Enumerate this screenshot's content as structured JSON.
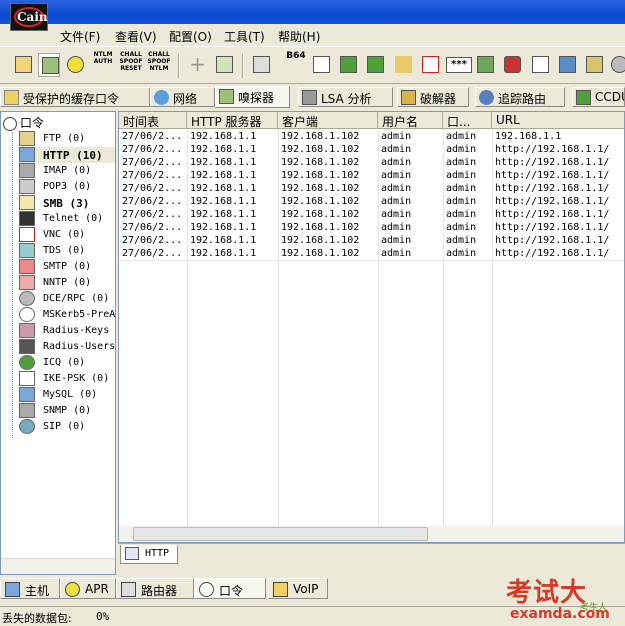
{
  "app": {
    "logo_text": "Cain"
  },
  "menu": [
    "文件(F)",
    "查看(V)",
    "配置(O)",
    "工具(T)",
    "帮助(H)"
  ],
  "toolbar_labels": {
    "ntlm_auth": "NTLM AUTH",
    "chall_spoof_reset": "CHALL SPOOF RESET",
    "chall_spoof_ntlm": "CHALL SPOOF NTLM",
    "b64": "B64",
    "stars": "***"
  },
  "main_tabs": [
    {
      "label": "受保护的缓存口令",
      "icon": "key-icon"
    },
    {
      "label": "网络",
      "icon": "globe-icon"
    },
    {
      "label": "嗅探器",
      "icon": "sniffer-icon"
    },
    {
      "label": "LSA 分析",
      "icon": "wrench-icon"
    },
    {
      "label": "破解器",
      "icon": "cracker-icon"
    },
    {
      "label": "追踪路由",
      "icon": "traceroute-icon"
    },
    {
      "label": "CCDU",
      "icon": "ccdu-icon"
    }
  ],
  "tree": {
    "root": "口令",
    "items": [
      {
        "label": "FTP  (0)",
        "icon": "ftp-icon",
        "bold": false
      },
      {
        "label": "HTTP  (10)",
        "icon": "http-icon",
        "bold": true
      },
      {
        "label": "IMAP  (0)",
        "icon": "imap-icon",
        "bold": false
      },
      {
        "label": "POP3  (0)",
        "icon": "pop3-icon",
        "bold": false
      },
      {
        "label": "SMB  (3)",
        "icon": "smb-icon",
        "bold": true
      },
      {
        "label": "Telnet  (0)",
        "icon": "telnet-icon",
        "bold": false
      },
      {
        "label": "VNC  (0)",
        "icon": "vnc-icon",
        "bold": false
      },
      {
        "label": "TDS  (0)",
        "icon": "tds-icon",
        "bold": false
      },
      {
        "label": "SMTP  (0)",
        "icon": "smtp-icon",
        "bold": false
      },
      {
        "label": "NNTP  (0)",
        "icon": "nntp-icon",
        "bold": false
      },
      {
        "label": "DCE/RPC  (0)",
        "icon": "dcerpc-icon",
        "bold": false
      },
      {
        "label": "MSKerb5-PreA",
        "icon": "kerberos-icon",
        "bold": false
      },
      {
        "label": "Radius-Keys",
        "icon": "radius-keys-icon",
        "bold": false
      },
      {
        "label": "Radius-Users",
        "icon": "radius-users-icon",
        "bold": false
      },
      {
        "label": "ICQ  (0)",
        "icon": "icq-icon",
        "bold": false
      },
      {
        "label": "IKE-PSK  (0)",
        "icon": "ike-icon",
        "bold": false
      },
      {
        "label": "MySQL  (0)",
        "icon": "mysql-icon",
        "bold": false
      },
      {
        "label": "SNMP  (0)",
        "icon": "snmp-icon",
        "bold": false
      },
      {
        "label": "SIP  (0)",
        "icon": "sip-icon",
        "bold": false
      }
    ]
  },
  "grid": {
    "columns": [
      "时间表",
      "HTTP 服务器",
      "客户端",
      "用户名",
      "口...",
      "URL"
    ],
    "rows": [
      [
        "27/06/2...",
        "192.168.1.1",
        "192.168.1.102",
        "admin",
        "admin",
        "192.168.1.1"
      ],
      [
        "27/06/2...",
        "192.168.1.1",
        "192.168.1.102",
        "admin",
        "admin",
        "http://192.168.1.1/"
      ],
      [
        "27/06/2...",
        "192.168.1.1",
        "192.168.1.102",
        "admin",
        "admin",
        "http://192.168.1.1/"
      ],
      [
        "27/06/2...",
        "192.168.1.1",
        "192.168.1.102",
        "admin",
        "admin",
        "http://192.168.1.1/"
      ],
      [
        "27/06/2...",
        "192.168.1.1",
        "192.168.1.102",
        "admin",
        "admin",
        "http://192.168.1.1/"
      ],
      [
        "27/06/2...",
        "192.168.1.1",
        "192.168.1.102",
        "admin",
        "admin",
        "http://192.168.1.1/"
      ],
      [
        "27/06/2...",
        "192.168.1.1",
        "192.168.1.102",
        "admin",
        "admin",
        "http://192.168.1.1/"
      ],
      [
        "27/06/2...",
        "192.168.1.1",
        "192.168.1.102",
        "admin",
        "admin",
        "http://192.168.1.1/"
      ],
      [
        "27/06/2...",
        "192.168.1.1",
        "192.168.1.102",
        "admin",
        "admin",
        "http://192.168.1.1/"
      ],
      [
        "27/06/2...",
        "192.168.1.1",
        "192.168.1.102",
        "admin",
        "admin",
        "http://192.168.1.1/"
      ]
    ]
  },
  "subtab": "HTTP",
  "bottom_tabs": [
    {
      "label": "主机",
      "icon": "host-icon"
    },
    {
      "label": "APR",
      "icon": "apr-icon"
    },
    {
      "label": "路由器",
      "icon": "router-icon"
    },
    {
      "label": "口令",
      "icon": "password-icon"
    },
    {
      "label": "VoIP",
      "icon": "voip-icon"
    }
  ],
  "status": {
    "label": "丢失的数据包:",
    "value": "0%"
  },
  "watermark": {
    "cn": "考试大",
    "en": "examda.com",
    "small": "考生人"
  },
  "colors": {
    "title_blue": "#0a4ad0",
    "selection_bg": "#ece9d8",
    "watermark_red": "#d63a28"
  }
}
